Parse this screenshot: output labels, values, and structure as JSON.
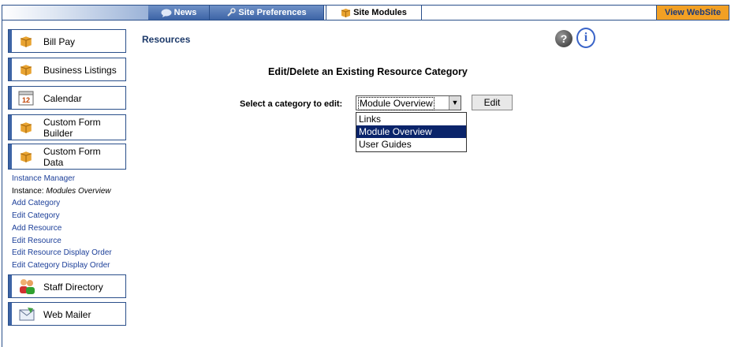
{
  "topnav": {
    "tabs": [
      {
        "label": "News",
        "icon": "speech-bubble-icon"
      },
      {
        "label": "Site Preferences",
        "icon": "wrench-icon"
      },
      {
        "label": "Site Modules",
        "icon": "package-icon"
      }
    ],
    "view_website": "View WebSite"
  },
  "sidebar": {
    "modules": [
      {
        "label": "Bill Pay",
        "icon": "package-icon"
      },
      {
        "label": "Business Listings",
        "icon": "package-icon"
      },
      {
        "label": "Calendar",
        "icon": "calendar-icon",
        "icon_text": "12"
      },
      {
        "label": "Custom Form Builder",
        "icon": "package-icon"
      },
      {
        "label": "Custom Form Data",
        "icon": "package-icon"
      },
      {
        "label": "Staff Directory",
        "icon": "people-icon"
      },
      {
        "label": "Web Mailer",
        "icon": "envelope-icon"
      }
    ],
    "sublinks": {
      "instance_manager": "Instance Manager",
      "instance_prefix": "Instance:",
      "instance_name": "Modules Overview",
      "add_category": "Add Category",
      "edit_category": "Edit Category",
      "add_resource": "Add Resource",
      "edit_resource": "Edit Resource",
      "edit_resource_order": "Edit Resource Display Order",
      "edit_category_order": "Edit Category Display Order"
    }
  },
  "main": {
    "title": "Resources",
    "help_symbol": "?",
    "info_symbol": "i",
    "heading": "Edit/Delete an Existing Resource Category",
    "select_label": "Select a category to edit:",
    "selected_value": "Module Overview",
    "options": [
      "Links",
      "Module Overview",
      "User Guides"
    ],
    "edit_button": "Edit"
  },
  "colors": {
    "accent": "#3d64a6",
    "view_website_bg": "#f2a024",
    "selected_option": "#0a246a"
  }
}
